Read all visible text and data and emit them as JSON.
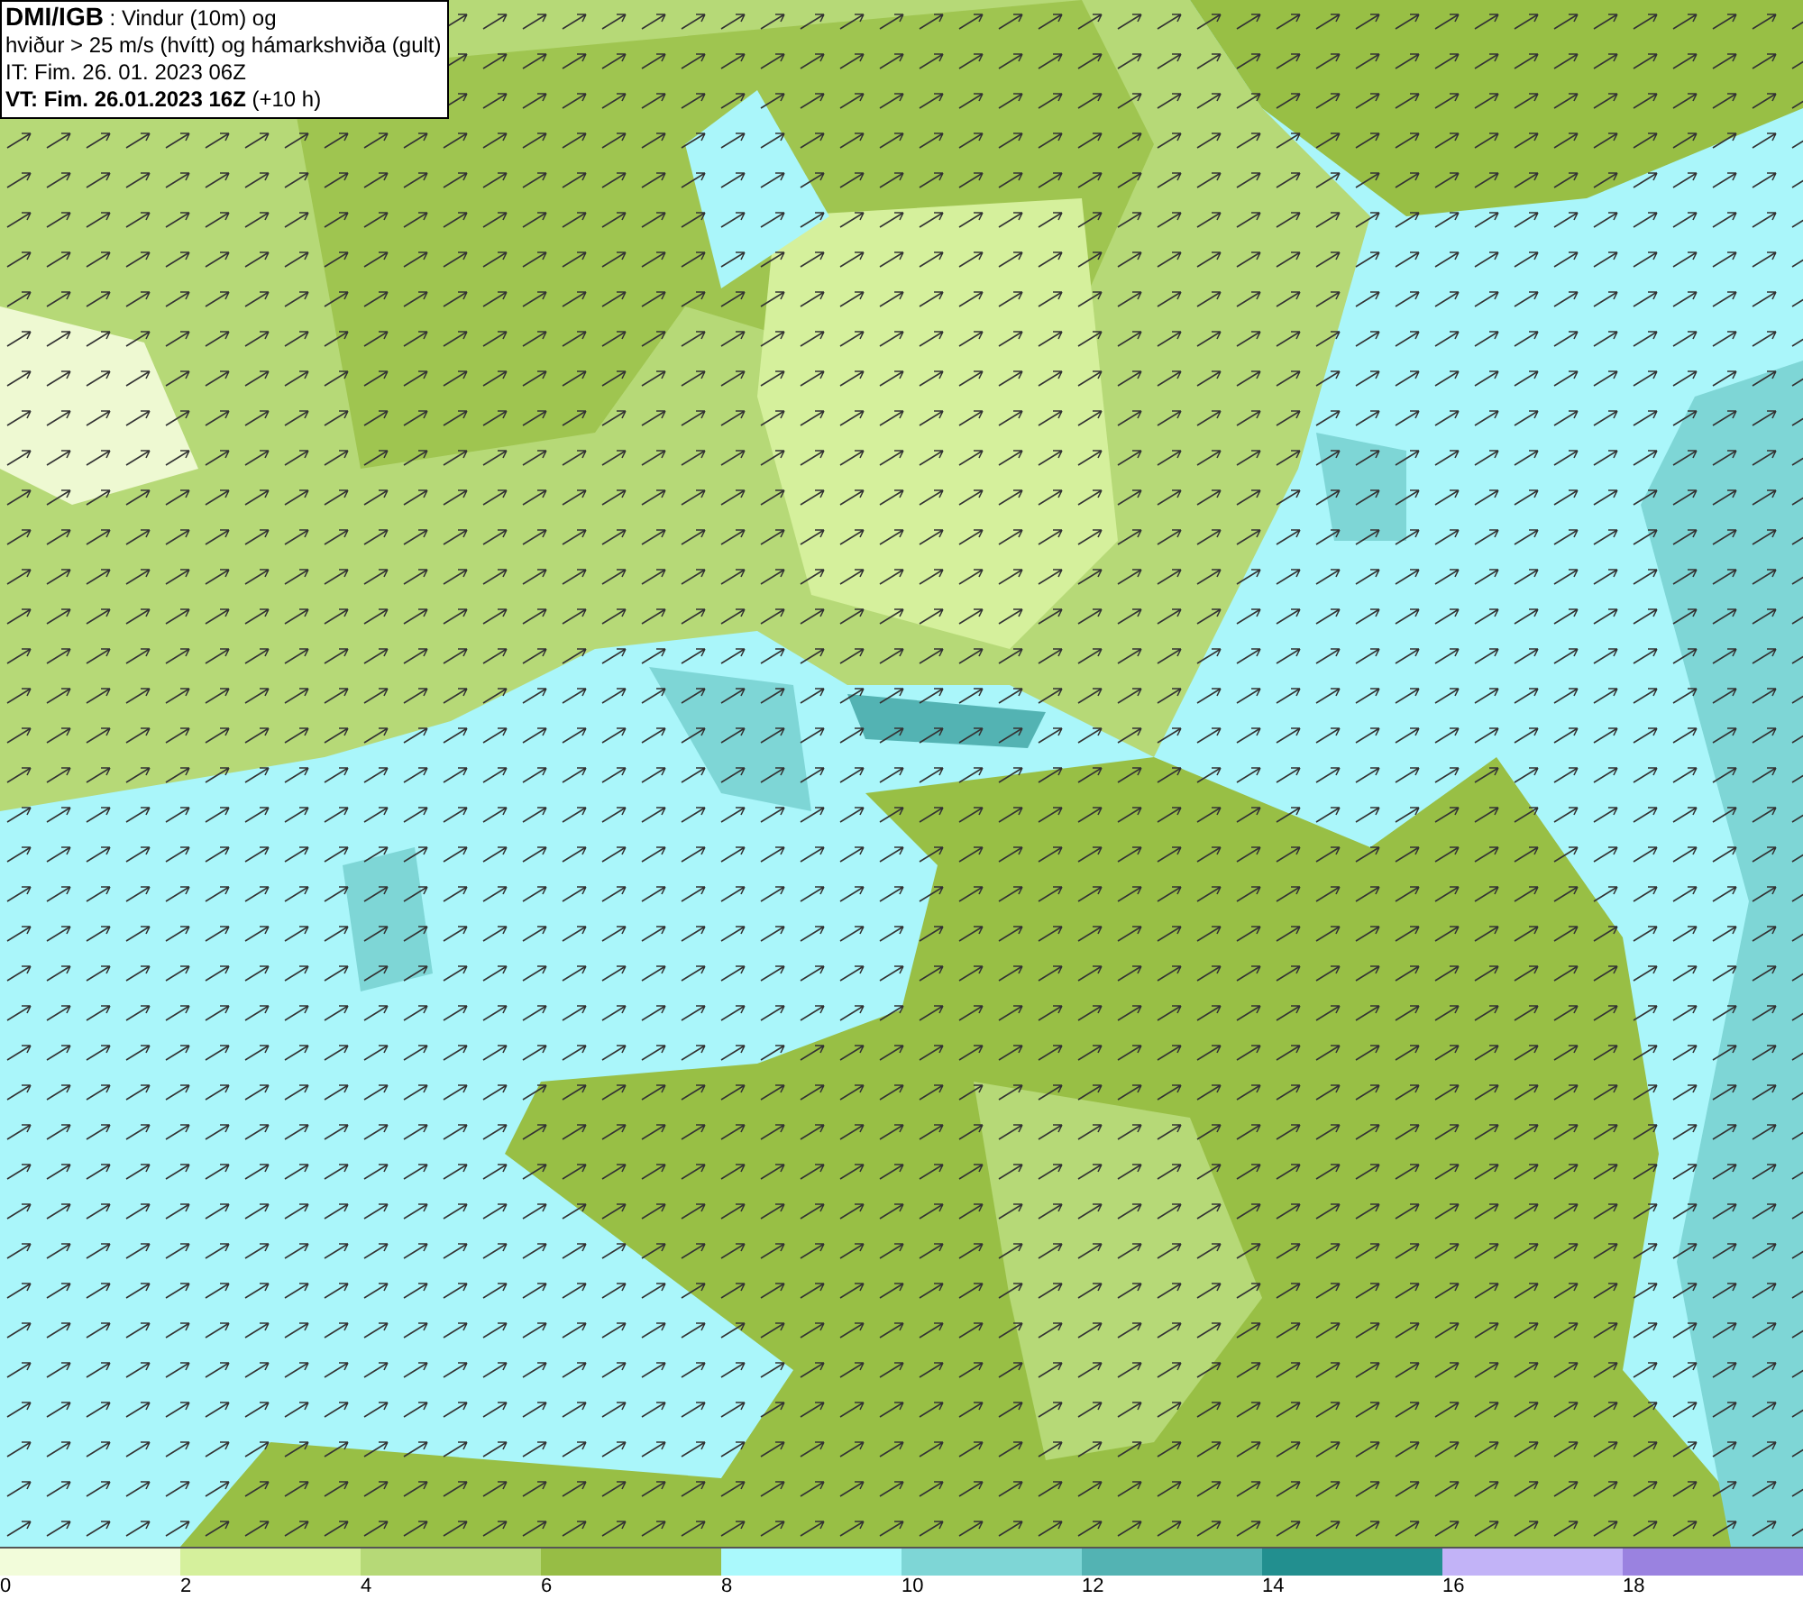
{
  "title_box": {
    "lines": [
      "**DMI/IGB** : Vindur (10m) og",
      "hviður > 25 m/s (hvítt) og hámarkshviða (gult)",
      "IT: Fim. 26. 01. 2023 06Z",
      "**VT: Fim. 26.01.2023 16Z** (+10 h)"
    ]
  },
  "legend": {
    "bins": [
      {
        "color": "#f2fcda"
      },
      {
        "color": "#d5f09c"
      },
      {
        "color": "#b6d977"
      },
      {
        "color": "#97bd45"
      },
      {
        "color": "#aaf9fc"
      },
      {
        "color": "#7ed6d6"
      },
      {
        "color": "#53b3b3"
      },
      {
        "color": "#228f8f"
      },
      {
        "color": "#c2b3f7"
      },
      {
        "color": "#9a82e0"
      }
    ],
    "labels": [
      "0",
      "2",
      "4",
      "6",
      "8",
      "10",
      "12",
      "14",
      "16",
      "18"
    ]
  }
}
